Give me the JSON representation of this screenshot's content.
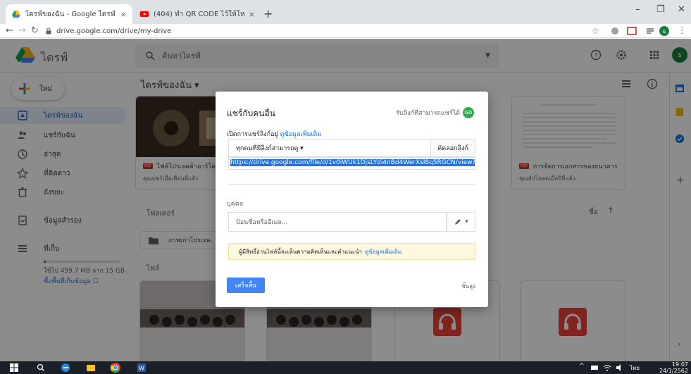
{
  "browser": {
    "tabs": [
      {
        "label": "ไดรฟ์ของฉัน - Google ไดรฟ์",
        "close": "×"
      },
      {
        "label": "(404) ทำ QR CODE ไว้ให้โหลด Pow",
        "close": "×"
      }
    ],
    "new_tab": "+",
    "window": {
      "minimize": "–",
      "maximize": "❐",
      "close": "✕"
    },
    "url": "drive.google.com/drive/my-drive",
    "profile_initial": "s"
  },
  "drive": {
    "app_title": "ไดรฟ์",
    "search_placeholder": "ค้นหาไดรฟ์",
    "avatar_initial": "s",
    "new_label": "ใหม่",
    "sidebar": [
      {
        "label": "ไดรฟ์ของฉัน",
        "icon": "drive-icon",
        "active": true
      },
      {
        "label": "แชร์กับฉัน",
        "icon": "people-icon"
      },
      {
        "label": "ล่าสุด",
        "icon": "clock-icon"
      },
      {
        "label": "ที่ติดดาว",
        "icon": "star-icon"
      },
      {
        "label": "ถังขยะ",
        "icon": "trash-icon"
      },
      {
        "label": "ข้อมูลสำรอง",
        "icon": "backup-icon"
      },
      {
        "label": "ที่เก็บ",
        "icon": "storage-icon"
      }
    ],
    "storage": {
      "used_fraction": 0.03,
      "text": "ใช้ไป 459.7 MB จาก 15 GB",
      "buy_link": "ซื้อพื้นที่เก็บข้อมูล ☐"
    },
    "breadcrumb": "ไดรฟ์ของฉัน ▾",
    "cards": [
      {
        "title": "ไฟล์โปรเจคค้าอาร์โค",
        "sub": "คุณแชร์เมื่อเดือนที่แล้ว"
      },
      {
        "title": "การจัดการเอกสารของธนาคาร...",
        "sub": "คุณอัปโหลดเมื่อปีที่แล้ว"
      }
    ],
    "folders_heading": "โฟลเดอร์",
    "folder_name": "ภาพเก่าโปรเจค",
    "files_heading": "ไฟล์",
    "sort_label": "ชื่อ",
    "sort_arrow": "↑"
  },
  "modal": {
    "title": "แชร์กับคนอื่น",
    "get_link": "รับลิงก์ที่สามารถแชร์ได้",
    "owner_initial": "GD",
    "link_on": "เปิดการแชร์ลิงก์อยู่",
    "learn_more": "ดูข้อมูลเพิ่มเติม",
    "permission": "ทุกคนที่มีลิงก์สามารถดู ▾",
    "copy_link": "คัดลอกลิงก์",
    "url": "https://drive.google.com/file/d/1v0iWUk1DjsLYdi4nBd4WerXsl8q5RGCN/view?usp=",
    "people_label": "บุคคล",
    "people_placeholder": "ป้อนชื่อหรืออีเมล...",
    "pen_caret": "▾",
    "notice": "ผู้มีสิทธิ์อ่านไฟล์นี้จะเห็นความคิดเห็นและคำแนะนำ",
    "notice_link": "ดูข้อมูลเพิ่มเติม",
    "done": "เสร็จสิ้น",
    "advanced": "ขั้นสูง"
  },
  "taskbar": {
    "lang": "ไทย",
    "time": "19:07",
    "date": "24/1/2562",
    "tray": "^"
  },
  "colors": {
    "blue": "#1a73e8",
    "drive_green": "#188038",
    "pdf_red": "#d93025",
    "done_blue": "#4285f4"
  }
}
